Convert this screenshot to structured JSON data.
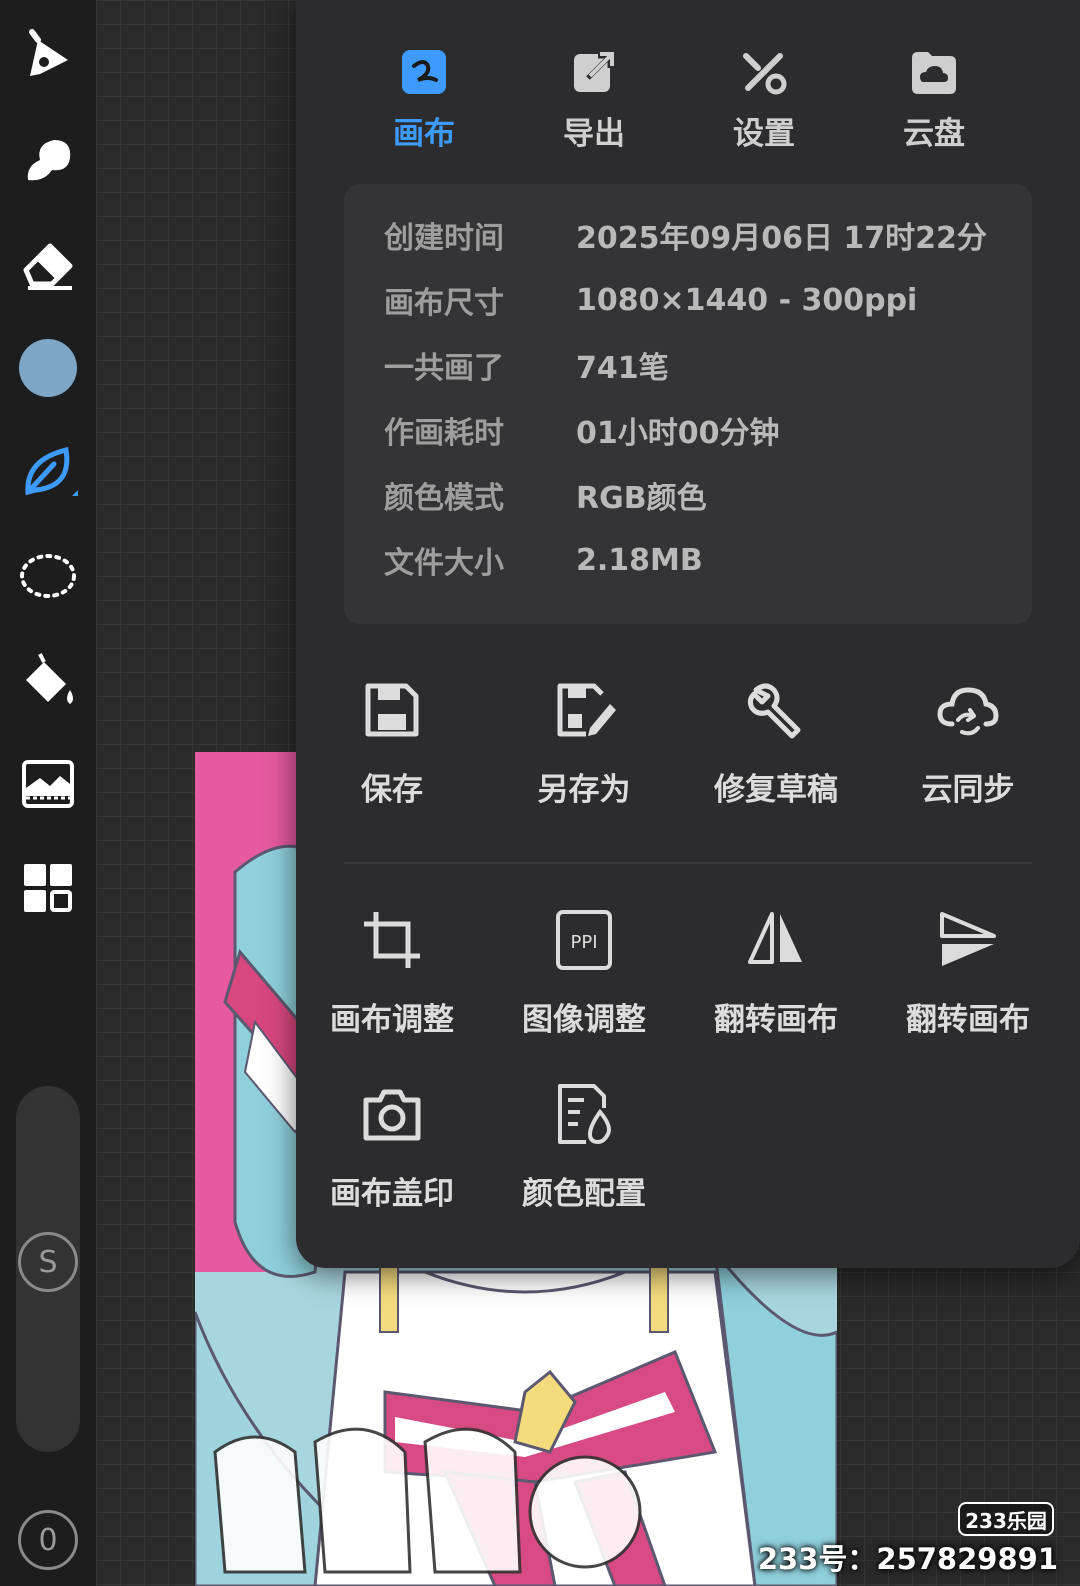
{
  "tabs": [
    {
      "label": "画布",
      "icon": "canvas-icon",
      "active": true
    },
    {
      "label": "导出",
      "icon": "export-icon",
      "active": false
    },
    {
      "label": "设置",
      "icon": "settings-icon",
      "active": false
    },
    {
      "label": "云盘",
      "icon": "cloud-drive-icon",
      "active": false
    }
  ],
  "info": [
    {
      "key": "创建时间",
      "value": "2025年09月06日 17时22分"
    },
    {
      "key": "画布尺寸",
      "value": "1080×1440 - 300ppi"
    },
    {
      "key": "一共画了",
      "value": "741笔"
    },
    {
      "key": "作画耗时",
      "value": "01小时00分钟"
    },
    {
      "key": "颜色模式",
      "value": "RGB颜色"
    },
    {
      "key": "文件大小",
      "value": "2.18MB"
    }
  ],
  "actions_row1": [
    {
      "label": "保存",
      "icon": "save-icon"
    },
    {
      "label": "另存为",
      "icon": "save-as-icon"
    },
    {
      "label": "修复草稿",
      "icon": "wrench-icon"
    },
    {
      "label": "云同步",
      "icon": "cloud-sync-icon"
    }
  ],
  "actions_row2": [
    {
      "label": "画布调整",
      "icon": "crop-icon"
    },
    {
      "label": "图像调整",
      "icon": "ppi-icon",
      "icon_text": "PPI"
    },
    {
      "label": "翻转画布",
      "icon": "flip-horizontal-icon"
    },
    {
      "label": "翻转画布",
      "icon": "flip-vertical-icon"
    }
  ],
  "actions_row3": [
    {
      "label": "画布盖印",
      "icon": "camera-icon"
    },
    {
      "label": "颜色配置",
      "icon": "color-config-icon"
    }
  ],
  "toolbar": {
    "current_color": "#7ea6c6",
    "size_button": "S",
    "opacity_button": "0"
  },
  "watermark": {
    "badge": "233乐园",
    "id_text": "233号：257829891"
  },
  "colors": {
    "accent": "#3d9bff",
    "panel": "#2c2c2e",
    "card": "#343436"
  }
}
